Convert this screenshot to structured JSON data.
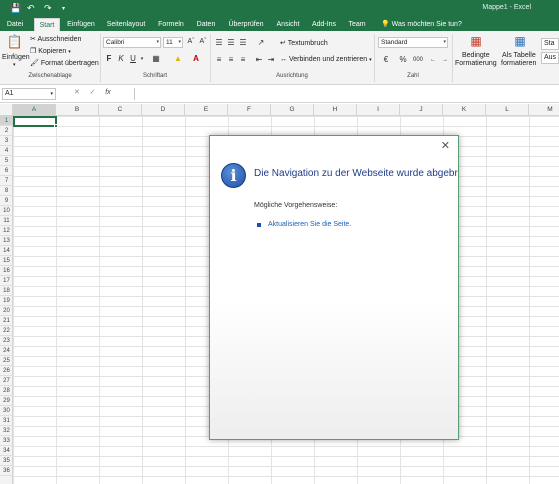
{
  "app": {
    "title": "Mappe1 - Excel"
  },
  "tabs": [
    {
      "label": "Datei"
    },
    {
      "label": "Start",
      "active": true
    },
    {
      "label": "Einfügen"
    },
    {
      "label": "Seitenlayout"
    },
    {
      "label": "Formeln"
    },
    {
      "label": "Daten"
    },
    {
      "label": "Überprüfen"
    },
    {
      "label": "Ansicht"
    },
    {
      "label": "Add-Ins"
    },
    {
      "label": "Team"
    }
  ],
  "tell_me": "Was möchten Sie tun?",
  "ribbon": {
    "clipboard": {
      "paste": "Einfügen",
      "cut": "Ausschneiden",
      "copy": "Kopieren",
      "format_painter": "Format übertragen",
      "group": "Zwischenablage"
    },
    "font": {
      "name": "Calibri",
      "size": "11",
      "bold": "F",
      "italic": "K",
      "underline": "U",
      "group": "Schriftart"
    },
    "alignment": {
      "wrap": "Textumbruch",
      "merge": "Verbinden und zentrieren",
      "group": "Ausrichtung"
    },
    "number": {
      "format": "Standard",
      "percent": "%",
      "thousands": "000",
      "group": "Zahl"
    },
    "styles": {
      "conditional": "Bedingte",
      "conditional2": "Formatierung",
      "as_table": "Als Tabelle",
      "as_table2": "formatieren",
      "partial1": "Sta",
      "partial2": "Aus"
    }
  },
  "formula_bar": {
    "name_box": "A1",
    "fx": "fx"
  },
  "columns": [
    "A",
    "B",
    "C",
    "D",
    "E",
    "F",
    "G",
    "H",
    "I",
    "J",
    "K",
    "L",
    "M"
  ],
  "rows": [
    "1",
    "2",
    "3",
    "4",
    "5",
    "6",
    "7",
    "8",
    "9",
    "10",
    "11",
    "12",
    "13",
    "14",
    "15",
    "16",
    "17",
    "18",
    "19",
    "20",
    "21",
    "22",
    "23",
    "24",
    "25",
    "26",
    "27",
    "28",
    "29",
    "30",
    "31",
    "32",
    "33",
    "34",
    "35",
    "36"
  ],
  "dialog": {
    "heading": "Die Navigation zu der Webseite wurde abgebrochen",
    "subheading": "Mögliche Vorgehensweise:",
    "link": "Aktualisieren Sie die Seite."
  }
}
